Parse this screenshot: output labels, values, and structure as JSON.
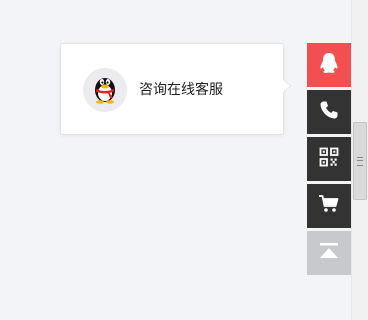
{
  "popover": {
    "label": "咨询在线客服",
    "avatar_icon": "qq-penguin-icon"
  },
  "toolbar": {
    "items": [
      {
        "name": "qq",
        "icon": "qq-penguin-icon",
        "bg": "#f25050"
      },
      {
        "name": "phone",
        "icon": "phone-icon",
        "bg": "#333333"
      },
      {
        "name": "qrcode",
        "icon": "qr-code-icon",
        "bg": "#333333"
      },
      {
        "name": "cart",
        "icon": "cart-icon",
        "bg": "#333333"
      },
      {
        "name": "back-to-top",
        "icon": "back-to-top-icon",
        "bg": "#c8c9cd"
      }
    ]
  },
  "colors": {
    "page_bg": "#f3f4f8",
    "accent": "#f25050",
    "dark": "#333333",
    "muted": "#c8c9cd"
  }
}
